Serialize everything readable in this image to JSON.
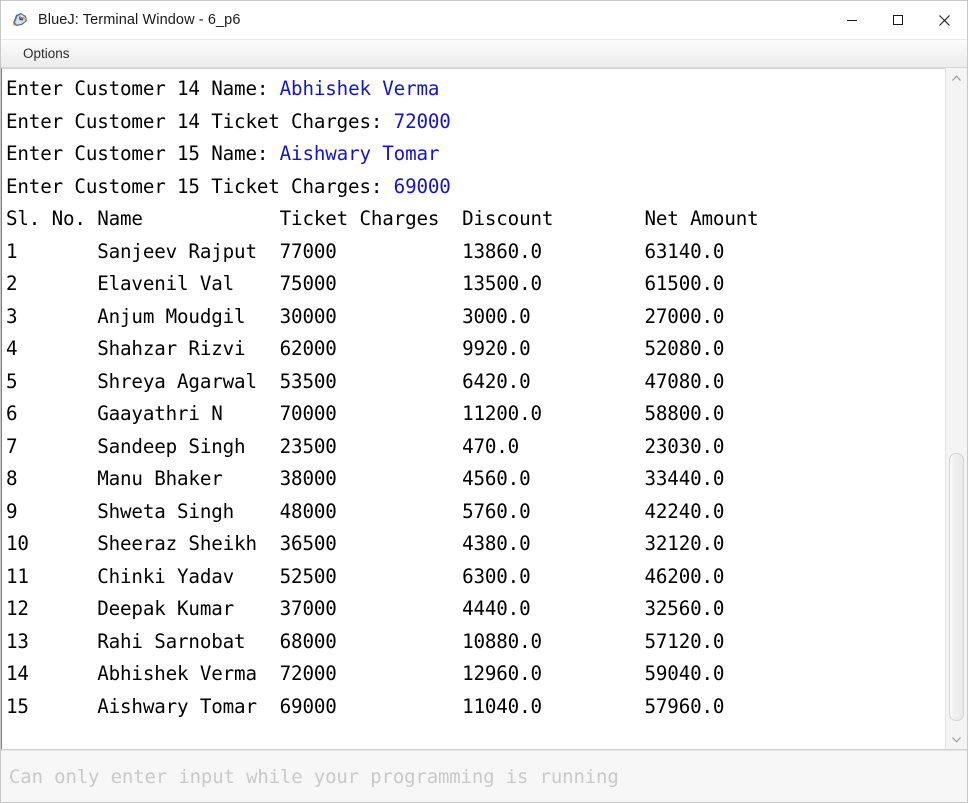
{
  "window": {
    "title": "BlueJ: Terminal Window - 6_p6",
    "icon": "bluej-penguin-icon",
    "controls": {
      "minimize": "minimize-icon",
      "maximize": "maximize-icon",
      "close": "close-icon"
    }
  },
  "menubar": {
    "items": [
      {
        "label": "Options"
      }
    ]
  },
  "terminal": {
    "prompt_lines": [
      {
        "prompt": "Enter Customer 14 Name: ",
        "input": "Abhishek Verma"
      },
      {
        "prompt": "Enter Customer 14 Ticket Charges: ",
        "input": "72000"
      },
      {
        "prompt": "Enter Customer 15 Name: ",
        "input": "Aishwary Tomar"
      },
      {
        "prompt": "Enter Customer 15 Ticket Charges: ",
        "input": "69000"
      }
    ],
    "table": {
      "headers": {
        "sl_no": "Sl. No.",
        "name": "Name",
        "ticket_charges": "Ticket Charges",
        "discount": "Discount",
        "net_amount": "Net Amount"
      },
      "header_line": "Sl. No. Name            Ticket Charges  Discount        Net Amount",
      "rows": [
        {
          "sl_no": "1",
          "name": "Sanjeev Rajput",
          "ticket_charges": "77000",
          "discount": "13860.0",
          "net_amount": "63140.0"
        },
        {
          "sl_no": "2",
          "name": "Elavenil Val",
          "ticket_charges": "75000",
          "discount": "13500.0",
          "net_amount": "61500.0"
        },
        {
          "sl_no": "3",
          "name": "Anjum Moudgil",
          "ticket_charges": "30000",
          "discount": "3000.0",
          "net_amount": "27000.0"
        },
        {
          "sl_no": "4",
          "name": "Shahzar Rizvi",
          "ticket_charges": "62000",
          "discount": "9920.0",
          "net_amount": "52080.0"
        },
        {
          "sl_no": "5",
          "name": "Shreya Agarwal",
          "ticket_charges": "53500",
          "discount": "6420.0",
          "net_amount": "47080.0"
        },
        {
          "sl_no": "6",
          "name": "Gaayathri N",
          "ticket_charges": "70000",
          "discount": "11200.0",
          "net_amount": "58800.0"
        },
        {
          "sl_no": "7",
          "name": "Sandeep Singh",
          "ticket_charges": "23500",
          "discount": "470.0",
          "net_amount": "23030.0"
        },
        {
          "sl_no": "8",
          "name": "Manu Bhaker",
          "ticket_charges": "38000",
          "discount": "4560.0",
          "net_amount": "33440.0"
        },
        {
          "sl_no": "9",
          "name": "Shweta Singh",
          "ticket_charges": "48000",
          "discount": "5760.0",
          "net_amount": "42240.0"
        },
        {
          "sl_no": "10",
          "name": "Sheeraz Sheikh",
          "ticket_charges": "36500",
          "discount": "4380.0",
          "net_amount": "32120.0"
        },
        {
          "sl_no": "11",
          "name": "Chinki Yadav",
          "ticket_charges": "52500",
          "discount": "6300.0",
          "net_amount": "46200.0"
        },
        {
          "sl_no": "12",
          "name": "Deepak Kumar",
          "ticket_charges": "37000",
          "discount": "4440.0",
          "net_amount": "32560.0"
        },
        {
          "sl_no": "13",
          "name": "Rahi Sarnobat",
          "ticket_charges": "68000",
          "discount": "10880.0",
          "net_amount": "57120.0"
        },
        {
          "sl_no": "14",
          "name": "Abhishek Verma",
          "ticket_charges": "72000",
          "discount": "12960.0",
          "net_amount": "59040.0"
        },
        {
          "sl_no": "15",
          "name": "Aishwary Tomar",
          "ticket_charges": "69000",
          "discount": "11040.0",
          "net_amount": "57960.0"
        }
      ]
    }
  },
  "statusbar": {
    "message": "Can only enter input while your programming is running"
  },
  "scrollbar": {
    "up_arrow": "chevron-up-icon",
    "down_arrow": "chevron-down-icon",
    "thumb_top_pct": 57,
    "thumb_height_pct": 41.5
  },
  "colors": {
    "input_text": "#1414d2",
    "output_text": "#000000",
    "status_text": "#c9c9c9"
  }
}
